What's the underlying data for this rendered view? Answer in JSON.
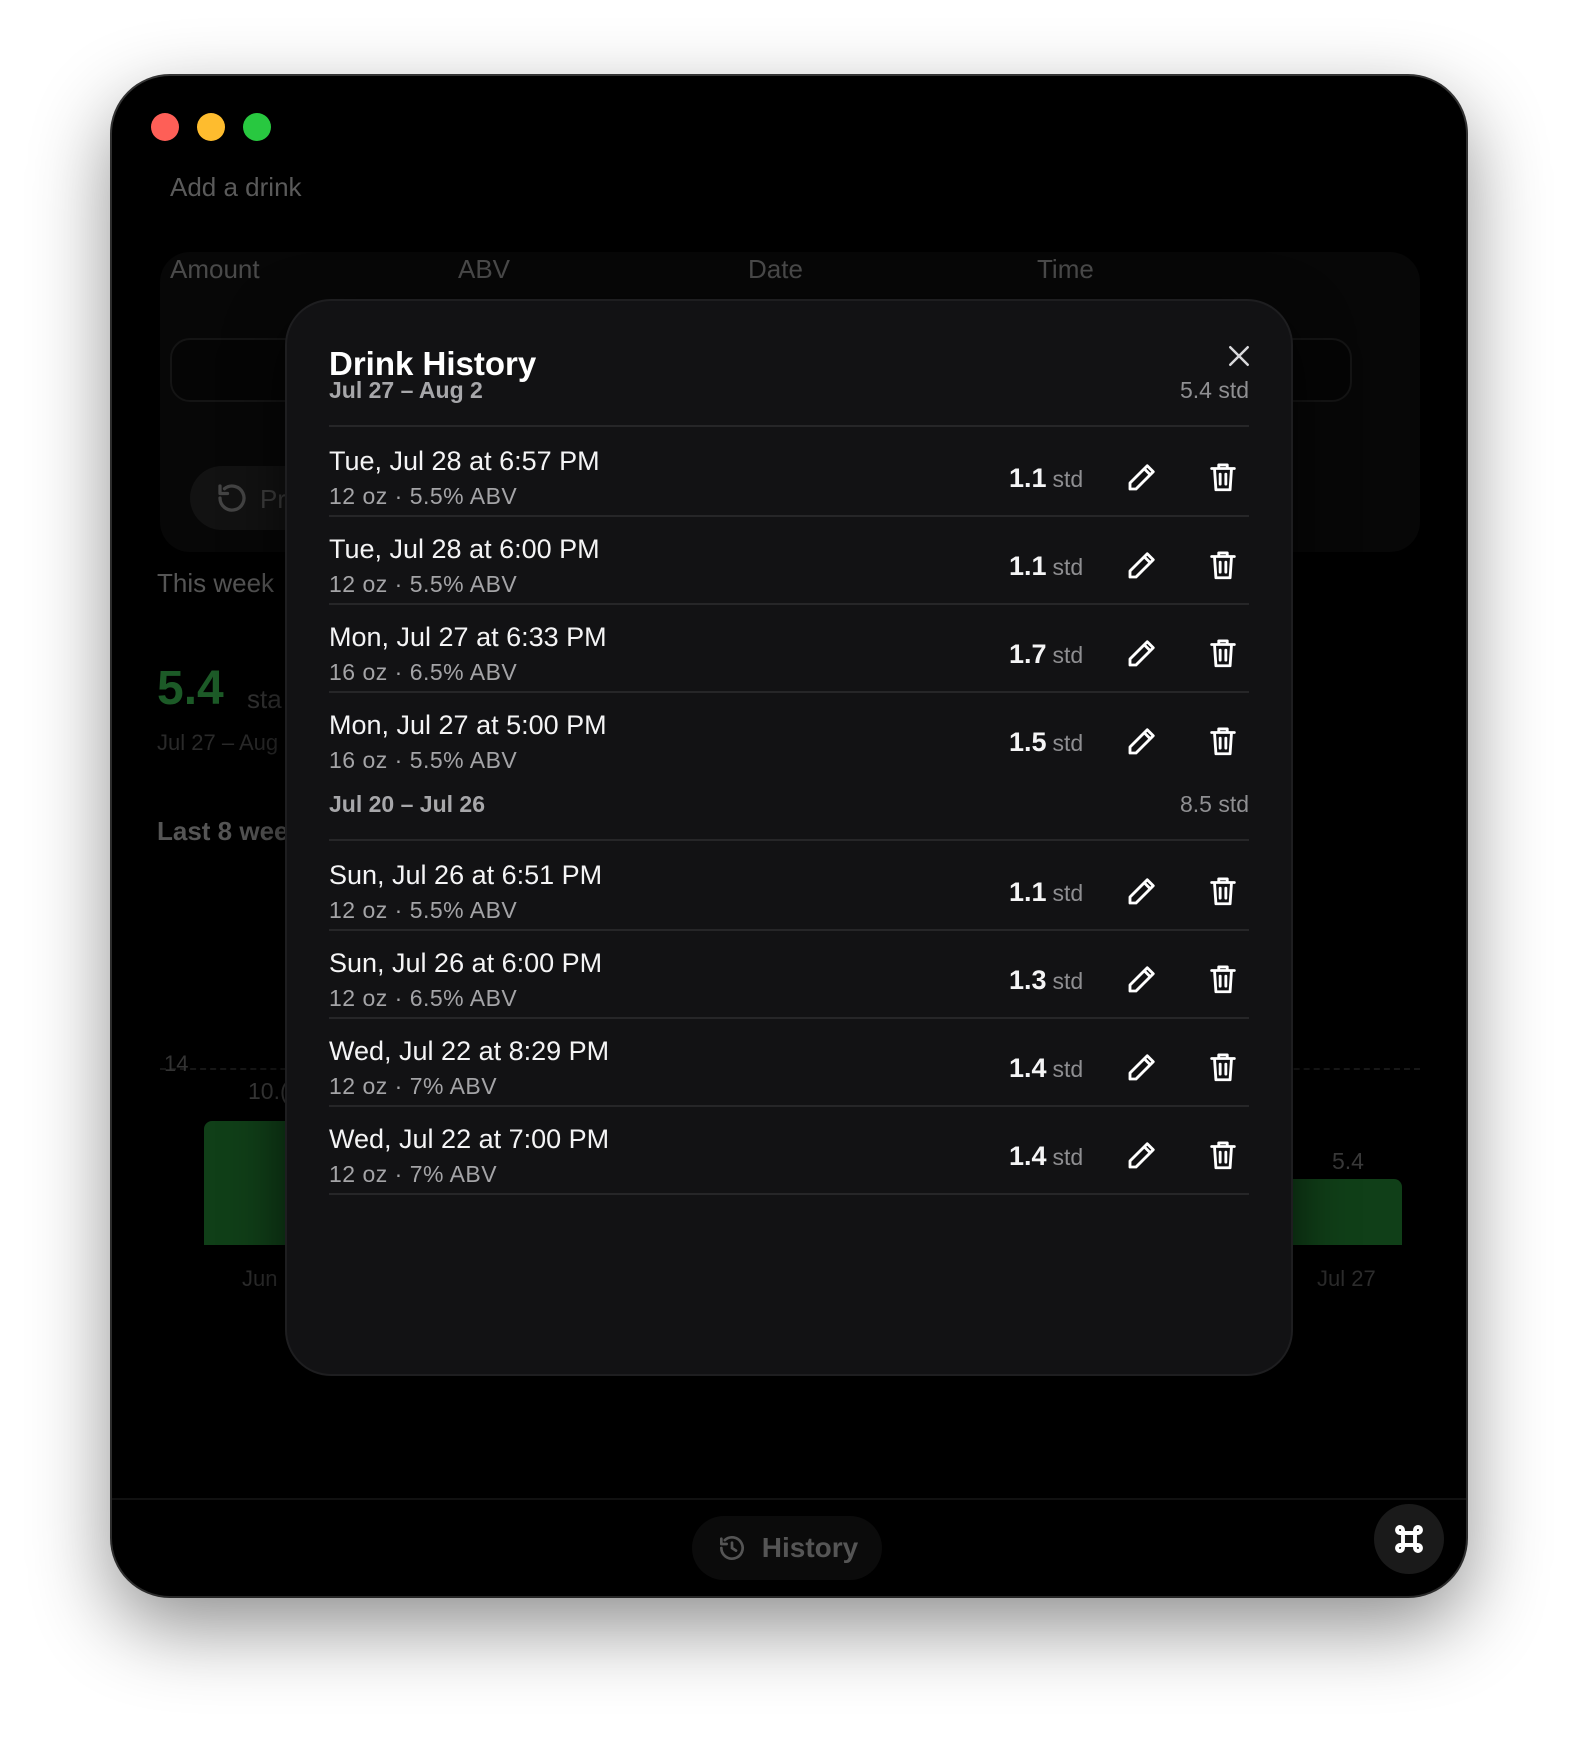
{
  "background": {
    "add_drink_label": "Add a drink",
    "fields": [
      "Amount",
      "ABV",
      "Date",
      "Time"
    ],
    "preset_fragment": "Pr",
    "this_week_label": "This week",
    "this_week_value": "5.4",
    "this_week_unit_fragment": "sta",
    "this_week_range_fragment": "Jul 27 – Aug",
    "last_weeks_fragment": "Last 8 wee",
    "chart_axis_max": "14",
    "bar_left_label_fragment": "10.(",
    "bar_right_label": "5.4",
    "axis_left_fragment": "Jun",
    "axis_right": "Jul 27"
  },
  "footer": {
    "history_label": "History"
  },
  "modal": {
    "title": "Drink History",
    "groups": [
      {
        "range": "Jul 27 – Aug 2",
        "total": "5.4 std",
        "entries": [
          {
            "title": "Tue, Jul 28 at 6:57 PM",
            "detail": "12 oz · 5.5% ABV",
            "std": "1.1",
            "unit": "std"
          },
          {
            "title": "Tue, Jul 28 at 6:00 PM",
            "detail": "12 oz · 5.5% ABV",
            "std": "1.1",
            "unit": "std"
          },
          {
            "title": "Mon, Jul 27 at 6:33 PM",
            "detail": "16 oz · 6.5% ABV",
            "std": "1.7",
            "unit": "std"
          },
          {
            "title": "Mon, Jul 27 at 5:00 PM",
            "detail": "16 oz · 5.5% ABV",
            "std": "1.5",
            "unit": "std"
          }
        ]
      },
      {
        "range": "Jul 20 – Jul 26",
        "total": "8.5 std",
        "entries": [
          {
            "title": "Sun, Jul 26 at 6:51 PM",
            "detail": "12 oz · 5.5% ABV",
            "std": "1.1",
            "unit": "std"
          },
          {
            "title": "Sun, Jul 26 at 6:00 PM",
            "detail": "12 oz · 6.5% ABV",
            "std": "1.3",
            "unit": "std"
          },
          {
            "title": "Wed, Jul 22 at 8:29 PM",
            "detail": "12 oz · 7% ABV",
            "std": "1.4",
            "unit": "std"
          },
          {
            "title": "Wed, Jul 22 at 7:00 PM",
            "detail": "12 oz · 7% ABV",
            "std": "1.4",
            "unit": "std"
          }
        ]
      }
    ]
  },
  "icons": {
    "close": "close-icon",
    "edit": "pencil-icon",
    "delete": "trash-icon",
    "history": "history-icon",
    "fab": "command-icon"
  },
  "colors": {
    "window_bg": "#000000",
    "modal_bg": "#121214",
    "accent_green": "#1c5a27"
  }
}
